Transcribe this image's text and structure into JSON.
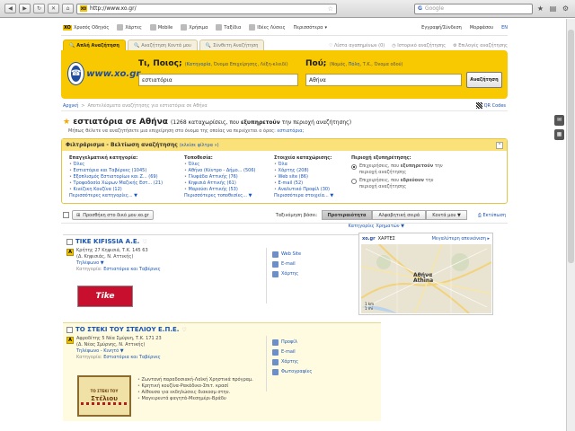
{
  "browser": {
    "url": "http://www.xo.gr/",
    "search_placeholder": "Google"
  },
  "toplinks": [
    "Χρυσός Οδηγός",
    "Χάρτες",
    "Mobile",
    "Χρήσιμα",
    "Ταξίδια",
    "Ιδέες Λύσεις",
    "Περισσότερα"
  ],
  "account": {
    "signin": "Εγγραφή/Σύνδεση",
    "lang": "Μορφάσου",
    "en": "EN"
  },
  "tabs": [
    "Απλή Αναζήτηση",
    "Αναζήτηση Κοντά μου",
    "Σύνθετη Αναζήτηση"
  ],
  "tab_links": [
    "Λίστα αγαπημένων (0)",
    "Ιστορικό αναζήτησης",
    "Επιλογές αναζήτησης"
  ],
  "search": {
    "logo": "www.xo.gr",
    "what_label": "Τι, Ποιος;",
    "what_hint_pre": "(",
    "what_hint_link": "Κατηγορία",
    "what_hint_rest": ", Όνομα Επιχείρησης, Λέξη-κλειδί)",
    "where_label": "Πού;",
    "where_hint_pre": "(Νομός, ",
    "where_hint_link": "Πόλη",
    "where_hint_rest": ", Τ.Κ., Όνομα οδού)",
    "what_value": "εστιατόρια",
    "where_value": "Αθήνα",
    "button": "Αναζήτηση"
  },
  "breadcrumb": {
    "home": "Αρχική",
    "sep": ">",
    "text": "Αποτελέσματα αναζήτησης για εστιατόρια σε Αθήνα",
    "qr": "QR Codes"
  },
  "results": {
    "title": "εστιατόρια σε Αθήνα",
    "count_pre": "(1268 καταχωρίσεις, που ",
    "count_bold": "εξυπηρετούν",
    "count_post": " την περιοχή αναζήτησης)",
    "sub_text": "Μήπως θέλετε να αναζητήσετε μια επιχείρηση στο όνομα της οποίας να περιέχεται ο όρος:",
    "sub_link": "εστιατόρια;"
  },
  "filters": {
    "title": "Φιλτράρισμα - Βελτίωση αναζήτησης",
    "hint": "(κλείσε φίλτρα »)",
    "col1": {
      "head": "Επαγγελματική κατηγορία:",
      "items": [
        "Όλες",
        "Εστιατόρια και Ταβέρνες (1045)",
        "Εξοπλισμός Εστιατορίων και Ζ... (69)",
        "Τροφοδοσία Χώρων Μαζικής Εστ... (21)",
        "Κινέζικη Κουζίνα (12)"
      ],
      "more": "Περισσότερες κατηγορίες... ▼"
    },
    "col2": {
      "head": "Τοποθεσία:",
      "items": [
        "Όλες",
        "Αθήνα (Κέντρο - Δήμο... (506)",
        "Γλυφάδα Αττικής (76)",
        "Κηφισιά Αττικής (61)",
        "Μαρούσι Αττικής (53)"
      ],
      "more": "Περισσότερες τοποθεσίες... ▼"
    },
    "col3": {
      "head": "Στοιχεία καταχώρισης:",
      "items": [
        "Όλα",
        "Χάρτης (208)",
        "Web site (86)",
        "E-mail (52)",
        "Αναλυτικό Προφίλ (30)"
      ],
      "more": "Περισσότερα στοιχεία... ▼"
    },
    "col4": {
      "head": "Περιοχή εξυπηρέτησης:",
      "opt1_pre": "Επιχειρήσεις, που ",
      "opt1_bold": "εξυπηρετούν",
      "opt1_post": " την περιοχή αναζήτησης",
      "opt2_pre": "Επιχειρήσεις, που ",
      "opt2_bold": "εδρεύουν",
      "opt2_post": " την περιοχή αναζήτησης"
    }
  },
  "sortbar": {
    "add": "Προσθήκη στο δικό μου xo.gr",
    "label": "Ταξινόμηση βάσει:",
    "opts": [
      "Προτεραιότητα",
      "Αλφαβητική σειρά",
      "Κοντά μου ▼"
    ],
    "print": "Εκτύπωση"
  },
  "category_link": "Κατηγορίες Χρηματών ▼",
  "listings": [
    {
      "name": "TIKE KIFISSIA A.E.",
      "heart": "♡",
      "badge": "A",
      "address": [
        "Κρήτης 27 Κηφισιά,  Τ.Κ.   145 63",
        "(Δ.  Κηφισιάς, Ν.   Αττικής)",
        "Τηλέφωνο ▼"
      ],
      "category_pre": "Κατηγορία: ",
      "category": "Εστιατόρια και Ταβέρνες",
      "actions": [
        "Web Site",
        "E-mail",
        "Χάρτης"
      ],
      "logo": "Tike"
    },
    {
      "name": "ΤΟ ΣΤΕΚΙ ΤΟΥ ΣΤΕΛΙΟΥ Ε.Π.Ε.",
      "heart": "♡",
      "badge": "A",
      "address": [
        "Αφροδίτης 5 Νέα Σμύρνη,  Τ.Κ.   171 23",
        "(Δ.  Νέας Σμύρνης, Ν.   Αττικής)",
        "Τηλέφωνο - Κινητό ▼"
      ],
      "category_pre": "Κατηγορία: ",
      "category": "Εστιατόρια και Ταβέρνες",
      "actions": [
        "Προφίλ",
        "E-mail",
        "Χάρτης",
        "Φωτογραφίες"
      ],
      "logo_top": "ΤΟ ΣΤΕΚΙ ΤΟΥ",
      "logo_main": "Στέλιου",
      "bullets": [
        "Ζωντανή παραδοσιακή-Λαϊκή Χρηστικά πρόγραμ.",
        "Κρητική κουζίνα-Ρακάδικο-Σπιτ. κρασί",
        "Αίθουσα για εκδηλώσεις διακοσμ στην.",
        "Μαγειρευτά φαγητά-Μεσημέρι-Βράδυ"
      ]
    }
  ],
  "map": {
    "brand": "xo.gr",
    "label": "ΧΑΡΤΕΣ",
    "bigger": "Μεγαλύτερη απεικόνιση ▸",
    "city_line1": "Αθήνα",
    "city_line2": "Athina",
    "scale1": "1 km",
    "scale2": "1 mi"
  }
}
